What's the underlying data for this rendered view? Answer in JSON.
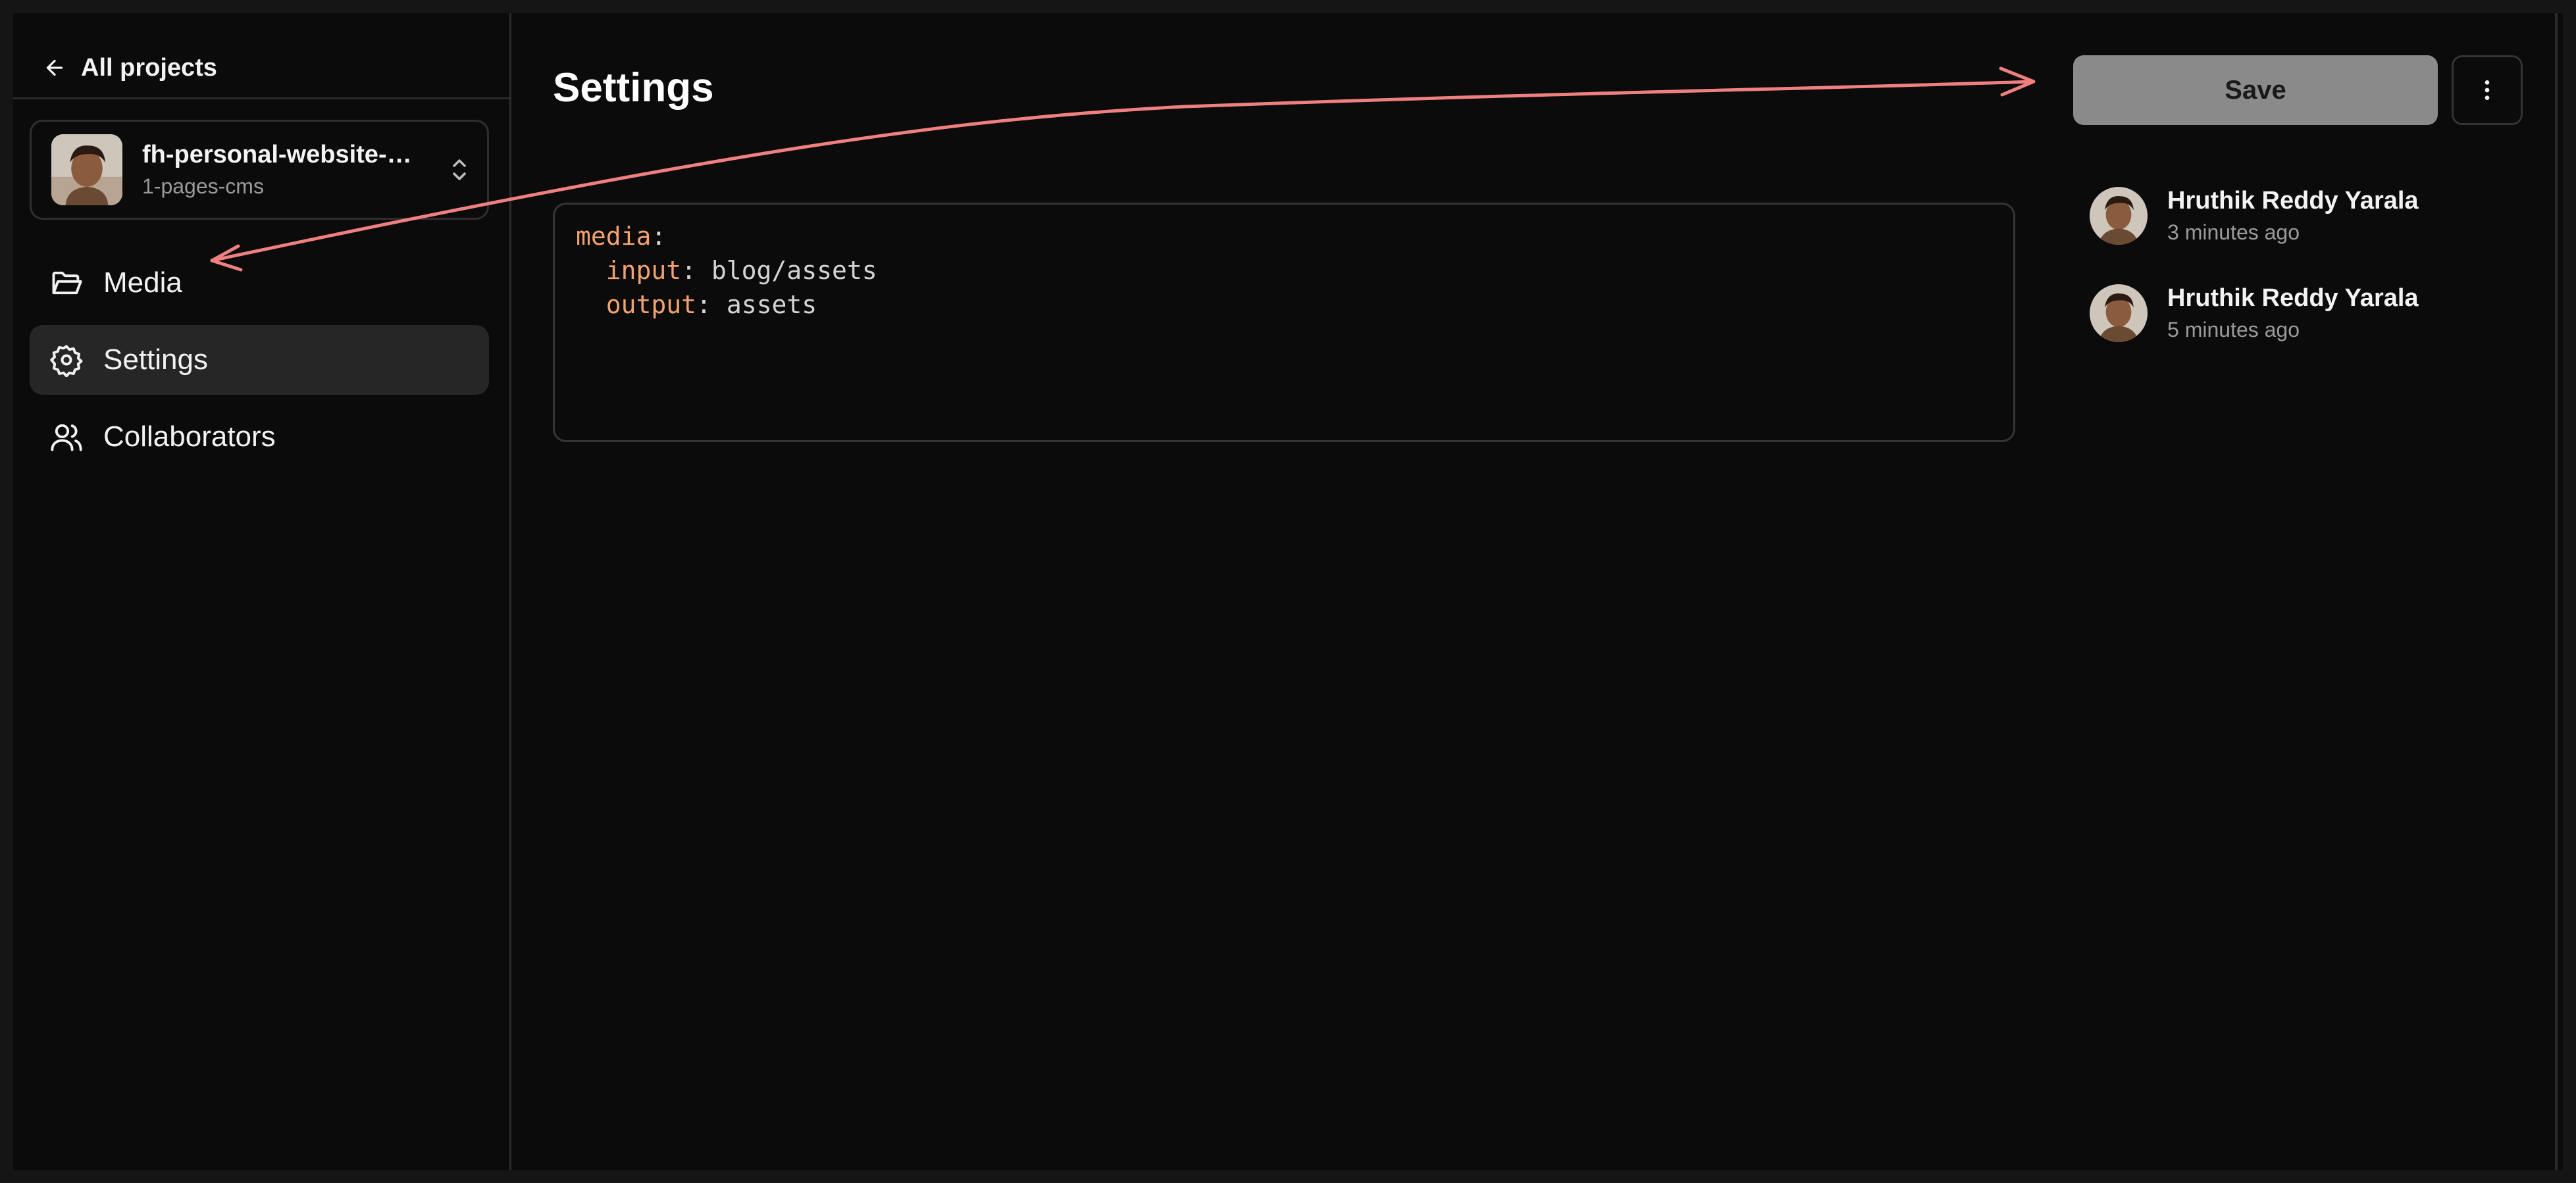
{
  "sidebar": {
    "back_label": "All projects",
    "project": {
      "name": "fh-personal-website-wi...",
      "subtitle": "1-pages-cms"
    },
    "items": [
      {
        "label": "Media",
        "icon": "folder-open-icon"
      },
      {
        "label": "Settings",
        "icon": "gear-icon"
      },
      {
        "label": "Collaborators",
        "icon": "users-icon"
      }
    ]
  },
  "main": {
    "title": "Settings",
    "code": {
      "line1_key": "media",
      "line2_key": "input",
      "line2_value": "blog/assets",
      "line3_key": "output",
      "line3_value": "assets"
    }
  },
  "toolbar": {
    "save_label": "Save",
    "more_icon": "more-vertical-icon"
  },
  "history": [
    {
      "name": "Hruthik Reddy Yarala",
      "time": "3 minutes ago"
    },
    {
      "name": "Hruthik Reddy Yarala",
      "time": "5 minutes ago"
    }
  ],
  "colors": {
    "background": "#0b0b0b",
    "yaml_key": "#f4a26d",
    "save_button": "#8a8a8a",
    "annotation_arrow": "#f08080"
  }
}
